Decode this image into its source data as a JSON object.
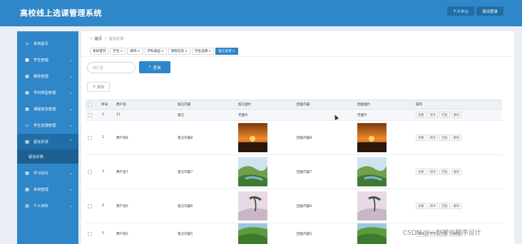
{
  "app": {
    "title": "高校线上选课管理系统"
  },
  "header": {
    "personal_label": "个人中心",
    "logout_label": "退出登录"
  },
  "sidebar": {
    "items": [
      {
        "label": "系统首页",
        "icon": "home-icon",
        "has_chevron": false
      },
      {
        "label": "学生管理",
        "icon": "user-icon",
        "has_chevron": true
      },
      {
        "label": "教师管理",
        "icon": "grid-icon",
        "has_chevron": true
      },
      {
        "label": "学科类型管理",
        "icon": "grid-icon",
        "has_chevron": true
      },
      {
        "label": "课程信息管理",
        "icon": "grid-icon",
        "has_chevron": true
      },
      {
        "label": "学生选课管理",
        "icon": "monitor-icon",
        "has_chevron": true
      },
      {
        "label": "留言反馈",
        "icon": "grid-icon",
        "has_chevron": true,
        "active": true
      },
      {
        "label": "学习论坛",
        "icon": "grid-icon",
        "has_chevron": true
      },
      {
        "label": "系统管理",
        "icon": "grid-icon",
        "has_chevron": true
      },
      {
        "label": "个人资料",
        "icon": "profile-icon",
        "has_chevron": true
      }
    ],
    "submenu_label": "留言反馈"
  },
  "breadcrumb": {
    "home": "首页",
    "current": "留言反馈"
  },
  "tabs": [
    "系统首页",
    "学生",
    "教师",
    "学科类型",
    "课程信息",
    "学生选课",
    "留言反馈"
  ],
  "active_tab_index": 6,
  "search": {
    "placeholder": "用户名",
    "button_label": "查询"
  },
  "toolbar": {
    "delete_label": "删除"
  },
  "table": {
    "columns": [
      "序号",
      "用户名",
      "留言内容",
      "留言图片",
      "回复内容",
      "回复图片",
      "操作"
    ],
    "rows": [
      {
        "index": "1",
        "username": "11",
        "message": "留言",
        "message_image": "无图片",
        "reply": "",
        "reply_image": "无图片"
      },
      {
        "index": "2",
        "username": "用户名8",
        "message": "留言内容8",
        "message_image": "sunset",
        "reply": "回复内容8",
        "reply_image": "sunset"
      },
      {
        "index": "3",
        "username": "用户名7",
        "message": "留言内容7",
        "message_image": "landscape",
        "reply": "回复内容7",
        "reply_image": "landscape"
      },
      {
        "index": "4",
        "username": "用户名6",
        "message": "留言内容6",
        "message_image": "mist",
        "reply": "回复内容6",
        "reply_image": "mist"
      },
      {
        "index": "5",
        "username": "用户名5",
        "message": "留言内容5",
        "message_image": "hills",
        "reply": "回复内容5",
        "reply_image": "hills"
      }
    ],
    "actions": [
      "查看",
      "修改",
      "回复",
      "删除"
    ]
  },
  "watermark": "CSDN @一赵学长程序设计",
  "colors": {
    "primary": "#2f86c8",
    "sidebar_active": "#1f6ea8",
    "submenu": "#1d5f92",
    "background": "#e9eef4"
  }
}
